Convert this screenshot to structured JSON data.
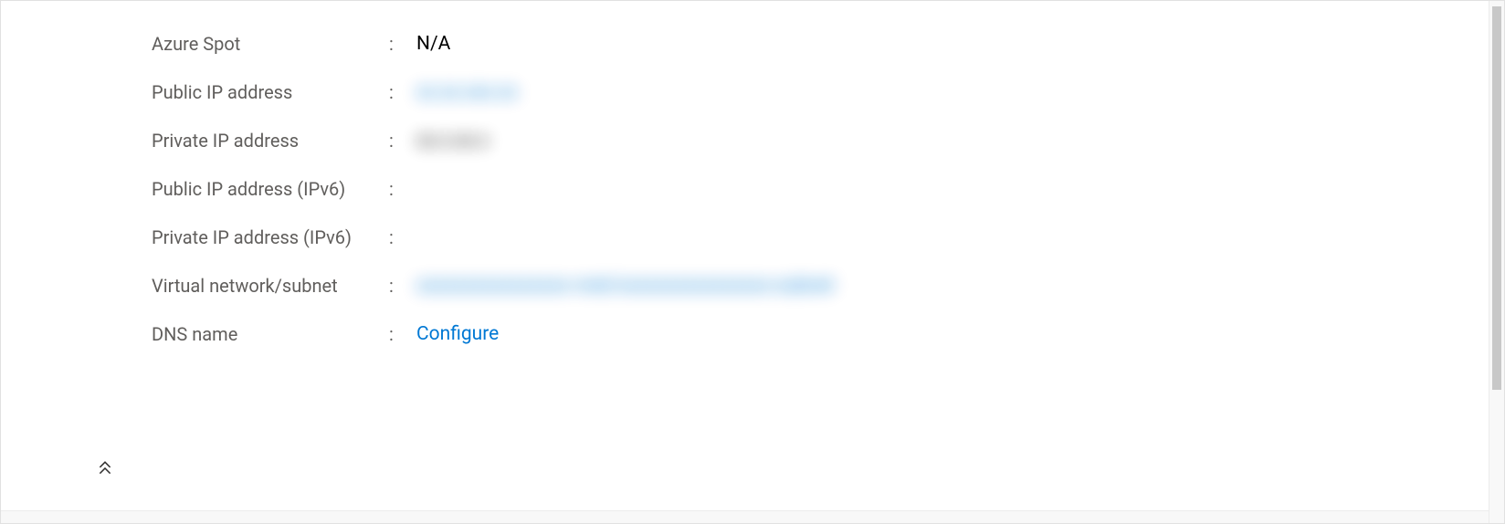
{
  "properties": {
    "rows": [
      {
        "key": "azure_spot",
        "label": "Azure Spot",
        "value": "N/A",
        "link": false,
        "blurred": false
      },
      {
        "key": "public_ip",
        "label": "Public IP address",
        "value": "xx.xx.xxx.xx",
        "link": true,
        "blurred": true
      },
      {
        "key": "private_ip",
        "label": "Private IP address",
        "value": "xx.x.xx.x",
        "link": false,
        "blurred": true
      },
      {
        "key": "public_ip_v6",
        "label": "Public IP address (IPv6)",
        "value": "",
        "link": false,
        "blurred": false
      },
      {
        "key": "private_ip_v6",
        "label": "Private IP address (IPv6)",
        "value": "",
        "link": false,
        "blurred": true
      },
      {
        "key": "vnet_subnet",
        "label": "Virtual network/subnet",
        "value": "xxxxxxxxxxxxxxxx-vnet/xxxxxxxxxxxxxxxx-subnet",
        "link": true,
        "blurred": true
      },
      {
        "key": "dns_name",
        "label": "DNS name",
        "value": "Configure",
        "link": true,
        "blurred": false
      }
    ]
  },
  "colon": ":"
}
